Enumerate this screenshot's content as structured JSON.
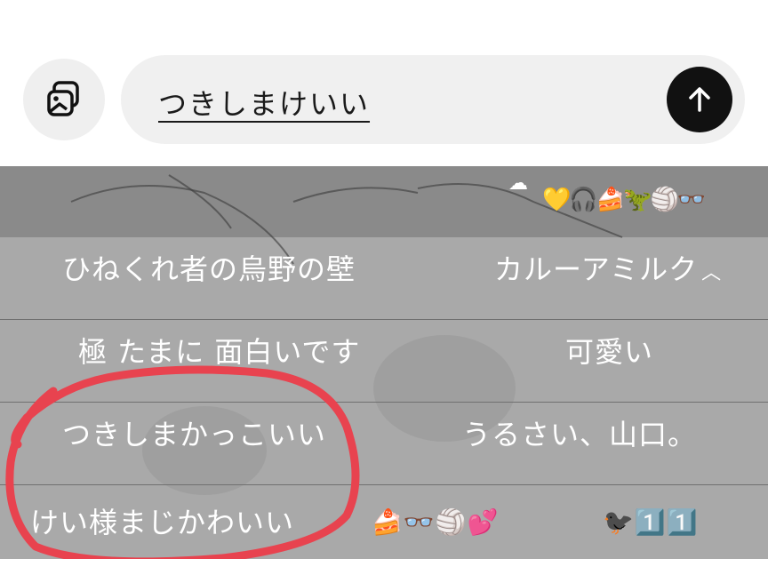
{
  "composer": {
    "text": "つきしまけいい",
    "media_icon": "gallery-icon",
    "send_icon": "arrow-up-icon"
  },
  "header_emoji": "💛🎧🍰🦖🏐👓",
  "answers": [
    {
      "left": "ひねくれ者の烏野の壁",
      "right": "カルーアミルク",
      "right_suffix": "^"
    },
    {
      "left": "極 たまに 面白いです",
      "right": "可愛い"
    },
    {
      "left": "つきしまかっこいい",
      "right": "うるさい、山口。"
    },
    {
      "left": "けい様まじかわいい",
      "left_emoji": "🍰👓🏐💕",
      "right": "🐦‍⬛1️⃣1️⃣"
    }
  ],
  "colors": {
    "accent_red": "#e8434f",
    "send_bg": "#111111",
    "overlay": "#a9a9a9"
  }
}
